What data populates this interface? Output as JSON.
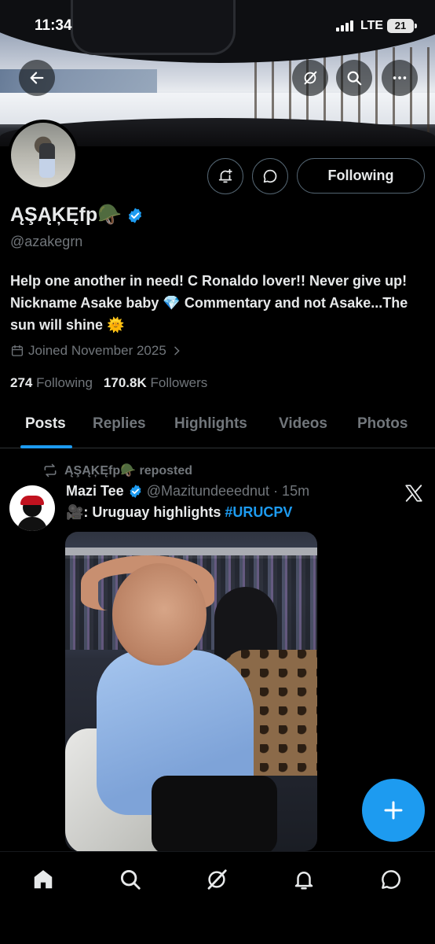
{
  "status_bar": {
    "time": "11:34",
    "network": "LTE",
    "battery": "21"
  },
  "profile": {
    "display_name": "ĄŞĄĶĘfp🪖",
    "handle": "@azakegrn",
    "bio": "Help one another in need! C Ronaldo lover!! Never give up! Nickname Asake baby 💎 Commentary and not Asake...The sun will shine 🌞",
    "joined": "Joined November 2025",
    "following_count": "274",
    "following_label": "Following",
    "followers_count": "170.8K",
    "followers_label": "Followers",
    "follow_button": "Following"
  },
  "tabs": [
    "Posts",
    "Replies",
    "Highlights",
    "Videos",
    "Photos"
  ],
  "post": {
    "repost_line": "ĄŞĄĶĘfp🪖 reposted",
    "author_name": "Mazi Tee",
    "author_handle": "@Mazitundeeednut",
    "time": "· 15m",
    "text_prefix": "🎥: Uruguay highlights ",
    "hashtag": "#URUCPV"
  },
  "icons": {
    "back": "back-arrow-icon",
    "grok": "grok-icon",
    "search": "search-icon",
    "more": "more-icon",
    "notify": "bell-plus-icon",
    "message": "message-icon",
    "verified": "verified-badge-icon",
    "calendar": "calendar-icon",
    "repost": "repost-icon",
    "compose": "plus-icon"
  },
  "colors": {
    "accent": "#1d9bf0",
    "secondary_text": "#71767b",
    "border": "#536471"
  }
}
